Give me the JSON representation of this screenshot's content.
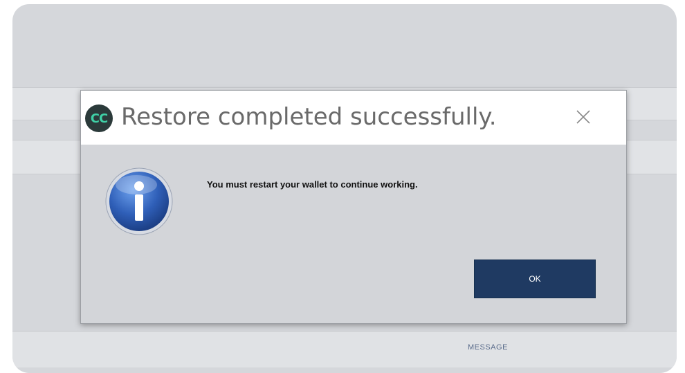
{
  "dialog": {
    "title": "Restore completed successfully.",
    "app_logo_text": "CC",
    "close_icon": "close-icon",
    "info_icon": "info-icon",
    "message": "You must restart your wallet to continue working.",
    "ok_label": "OK"
  },
  "footer": {
    "label": "MESSAGE"
  },
  "colors": {
    "ok_button_bg": "#1f3a62",
    "title_text": "#6a6a6a",
    "info_icon_blue": "#2f5fb8",
    "logo_green": "#3fd0a6"
  }
}
